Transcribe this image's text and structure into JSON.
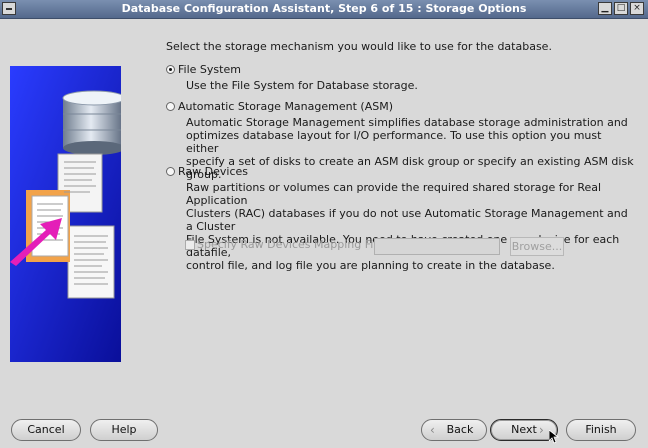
{
  "window": {
    "title": "Database Configuration Assistant, Step 6 of 15 : Storage Options",
    "controls": [
      "minimize-icon",
      "maximize-icon",
      "close-icon"
    ]
  },
  "prompt": "Select the storage mechanism you would like to use for the database.",
  "options": [
    {
      "label": "File System",
      "selected": true,
      "description": [
        "Use the File System for Database storage."
      ]
    },
    {
      "label": "Automatic Storage Management (ASM)",
      "selected": false,
      "description": [
        "Automatic Storage Management simplifies database storage administration and",
        "optimizes database layout for I/O performance. To use this option you must either",
        "specify a set of disks to create an ASM disk group or specify an existing ASM disk group."
      ]
    },
    {
      "label": "Raw Devices",
      "selected": false,
      "description": [
        "Raw partitions or volumes can provide the required shared storage for Real Application",
        "Clusters (RAC) databases if you do not use Automatic Storage Management and a Cluster",
        "File System is not available.  You need to have created one raw device for each datafile,",
        "control file, and log file you are planning to create in the database."
      ]
    }
  ],
  "raw_mapping": {
    "checkbox_label": "Specify Raw Devices Mapping File",
    "checked": false,
    "path_value": "",
    "browse_label": "Browse..."
  },
  "buttons": {
    "cancel": "Cancel",
    "help": "Help",
    "back": "Back",
    "next": "Next",
    "finish": "Finish"
  }
}
